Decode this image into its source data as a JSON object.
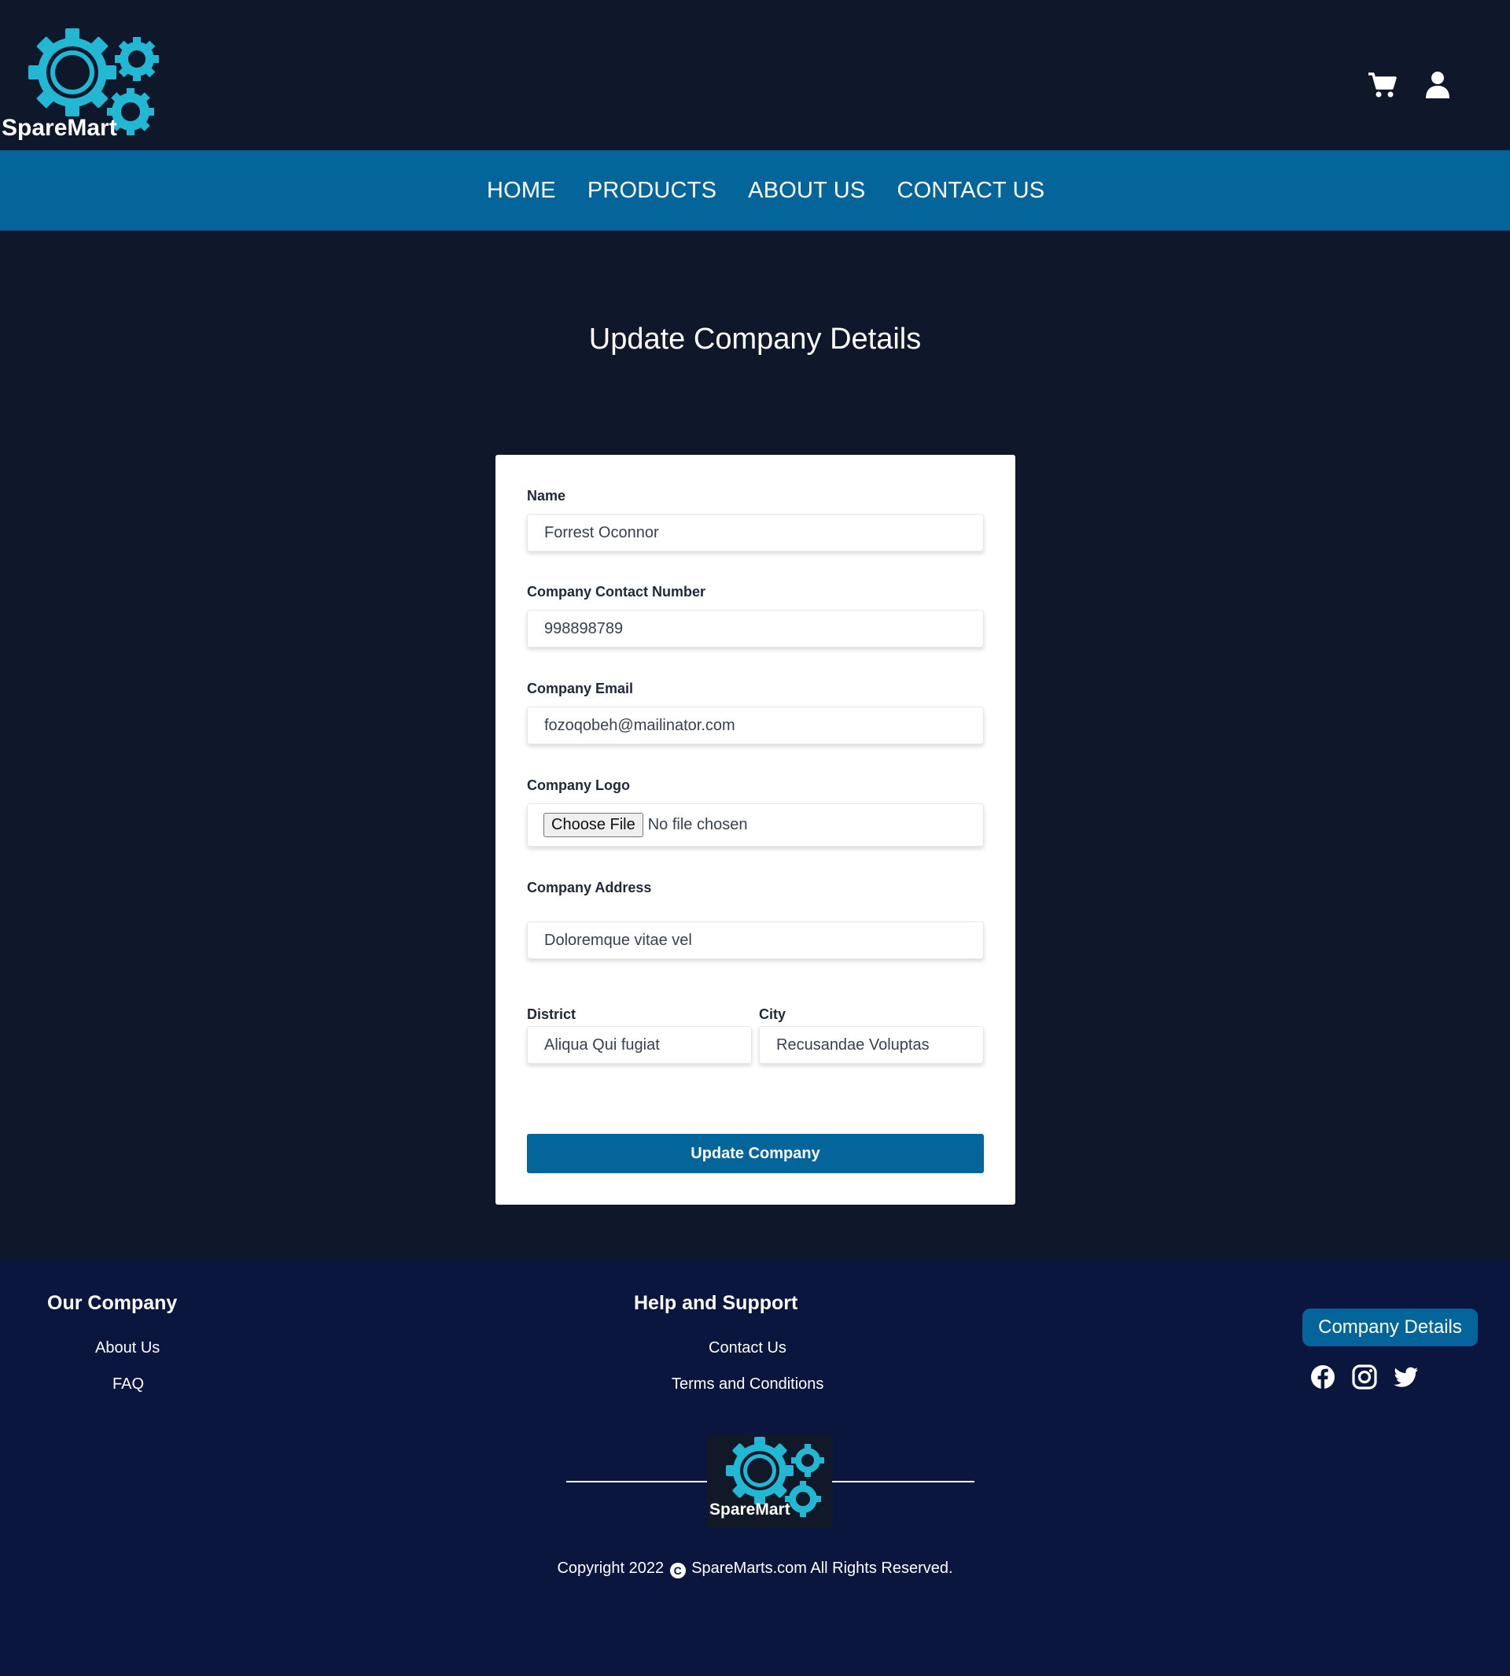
{
  "header": {
    "logo_text": "SpareMart",
    "cart_icon": "cart-icon",
    "user_icon": "user-icon"
  },
  "nav": {
    "items": [
      {
        "label": "HOME"
      },
      {
        "label": "PRODUCTS"
      },
      {
        "label": "ABOUT US"
      },
      {
        "label": "CONTACT US"
      }
    ]
  },
  "main": {
    "title": "Update Company Details"
  },
  "form": {
    "name_label": "Name",
    "name_value": "Forrest Oconnor",
    "contact_label": "Company Contact Number",
    "contact_value": "998898789",
    "email_label": "Company Email",
    "email_value": "fozoqobeh@mailinator.com",
    "logo_label": "Company Logo",
    "logo_button": "Choose File",
    "logo_status": "No file chosen",
    "address_label": "Company Address",
    "address_value": "Doloremque vitae vel",
    "district_label": "District",
    "district_value": "Aliqua Qui fugiat",
    "city_label": "City",
    "city_value": "Recusandae Voluptas",
    "submit_label": "Update Company"
  },
  "footer": {
    "our_company_heading": "Our Company",
    "about_link": "About Us",
    "faq_link": "FAQ",
    "help_heading": "Help and Support",
    "contact_link": "Contact Us",
    "terms_link": "Terms and Conditions",
    "company_details_button": "Company Details",
    "social_icons": [
      "facebook-icon",
      "instagram-icon",
      "twitter-icon"
    ],
    "logo_text": "SpareMart",
    "copyright_prefix": "Copyright 2022",
    "copyright_symbol": "C",
    "copyright_suffix": "SpareMarts.com All Rights Reserved."
  },
  "colors": {
    "background": "#0f172a",
    "nav": "#04659a",
    "footer": "#0b163e",
    "accent": "#22b8d4"
  }
}
